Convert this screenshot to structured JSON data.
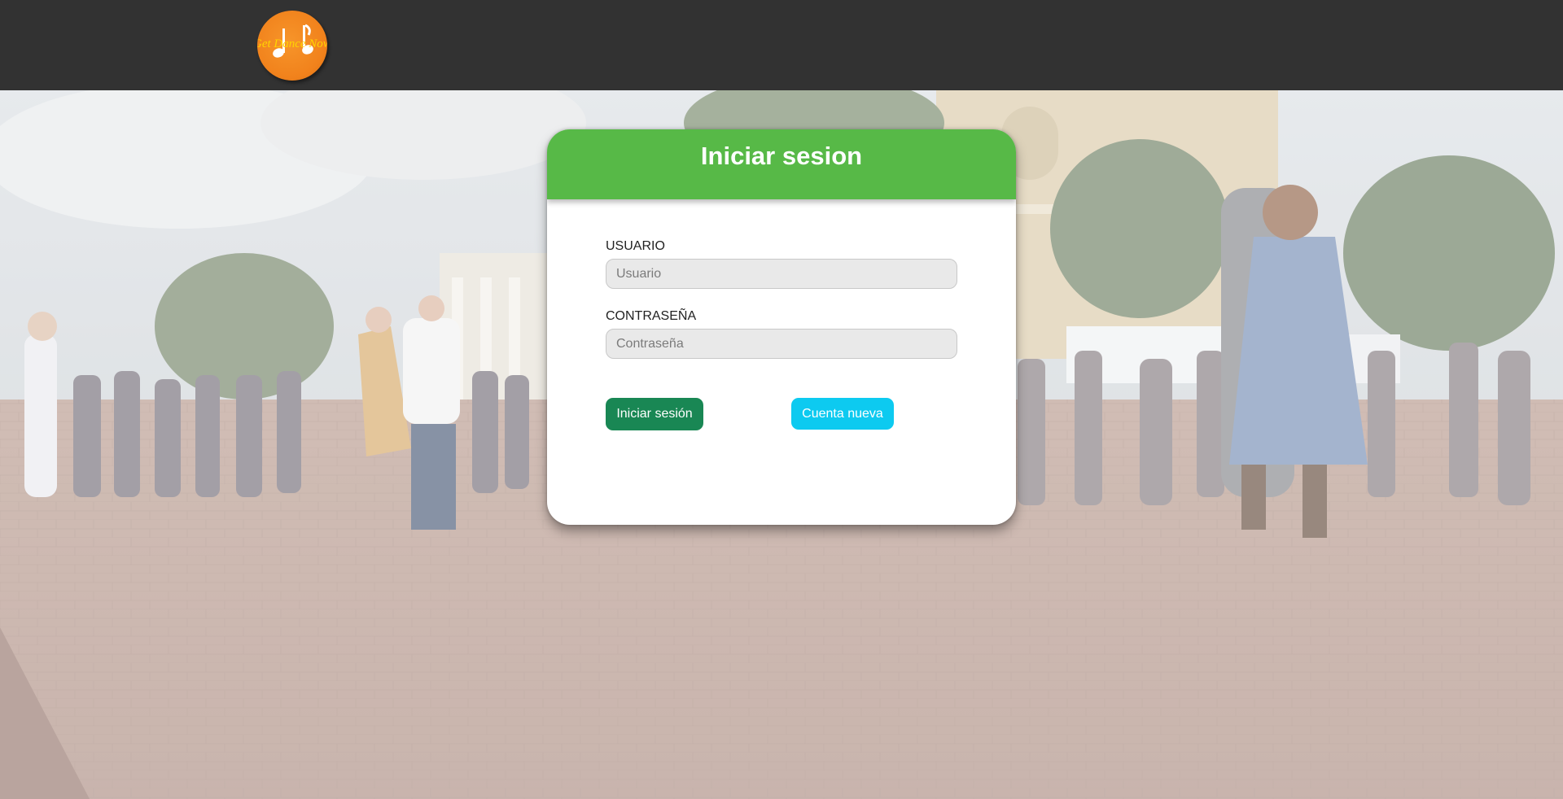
{
  "brand": {
    "logo_text": "Get Dance Now!",
    "logo_icon": "music-note-icon",
    "colors": {
      "logo_bg": "#f1821c",
      "logo_text": "#ffd400",
      "navbar": "#323232"
    }
  },
  "login": {
    "title": "Iniciar sesion",
    "header_color": "#57b947",
    "username": {
      "label": "USUARIO",
      "placeholder": "Usuario",
      "value": ""
    },
    "password": {
      "label": "CONTRASEÑA",
      "placeholder": "Contraseña",
      "value": ""
    },
    "submit_label": "Iniciar sesión",
    "submit_color": "#198754",
    "new_account_label": "Cuenta nueva",
    "new_account_color": "#0dcaf0"
  },
  "background": {
    "subject": "dance-scene-photo"
  }
}
